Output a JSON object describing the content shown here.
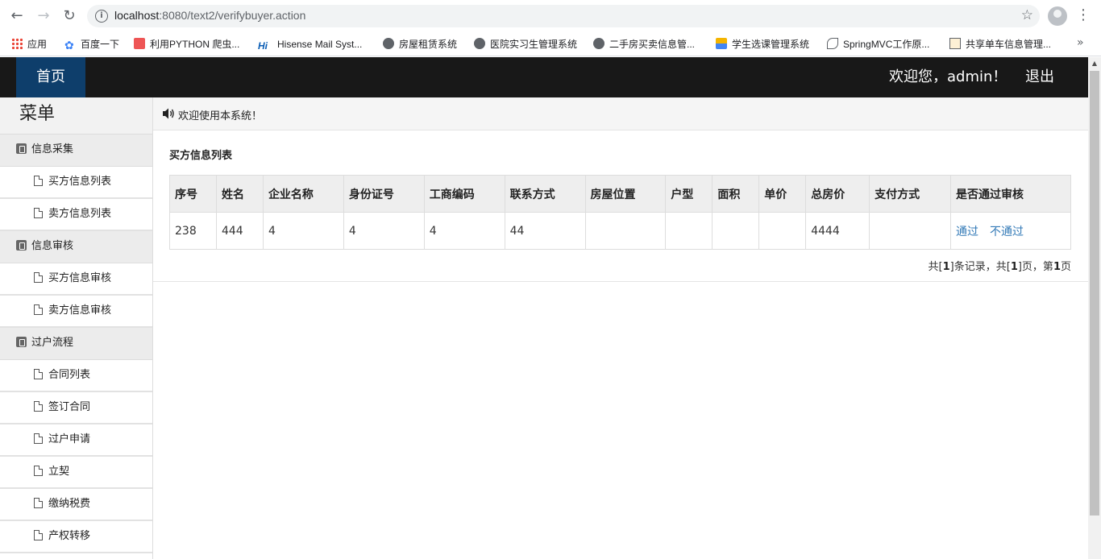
{
  "browser": {
    "url_host": "localhost",
    "url_path": ":8080/text2/verifybuyer.action",
    "bookmarks": [
      {
        "label": "应用",
        "icon": "apps-grid-icon"
      },
      {
        "label": "百度一下",
        "icon": "paw-icon"
      },
      {
        "label": "利用PYTHON 爬虫...",
        "icon": "red-square-icon"
      },
      {
        "label": "Hisense Mail Syst...",
        "icon": "hi-logo-icon"
      },
      {
        "label": "房屋租赁系统",
        "icon": "globe-icon"
      },
      {
        "label": "医院实习生管理系统",
        "icon": "globe-icon"
      },
      {
        "label": "二手房买卖信息管...",
        "icon": "globe-icon"
      },
      {
        "label": "学生选课管理系统",
        "icon": "flag-icon"
      },
      {
        "label": "SpringMVC工作原...",
        "icon": "leaf-icon"
      },
      {
        "label": "共享单车信息管理...",
        "icon": "picture-icon"
      }
    ],
    "more_label": "»"
  },
  "header": {
    "home_label": "首页",
    "welcome_text": "欢迎您，admin！",
    "logout_label": "退出"
  },
  "sidebar": {
    "title": "菜单",
    "groups": [
      {
        "label": "信息采集",
        "items": [
          "买方信息列表",
          "卖方信息列表"
        ]
      },
      {
        "label": "信息审核",
        "items": [
          "买方信息审核",
          "卖方信息审核"
        ]
      },
      {
        "label": "过户流程",
        "items": [
          "合同列表",
          "签订合同",
          "过户申请",
          "立契",
          "缴纳税费",
          "产权转移"
        ]
      }
    ]
  },
  "notice": {
    "text": "欢迎使用本系统！"
  },
  "panel": {
    "title": "买方信息列表",
    "columns": [
      "序号",
      "姓名",
      "企业名称",
      "身份证号",
      "工商编码",
      "联系方式",
      "房屋位置",
      "户型",
      "面积",
      "单价",
      "总房价",
      "支付方式",
      "是否通过审核"
    ],
    "rows": [
      {
        "cells": [
          "238",
          "444",
          "4",
          "4",
          "4",
          "44",
          "",
          "",
          "",
          "",
          "4444",
          ""
        ],
        "approve": "通过",
        "reject": "不通过"
      }
    ],
    "pager": {
      "p1": "共[",
      "total": "1",
      "p2": "]条记录，共[",
      "pages": "1",
      "p3": "]页，第",
      "current": "1",
      "p4": "页"
    }
  }
}
